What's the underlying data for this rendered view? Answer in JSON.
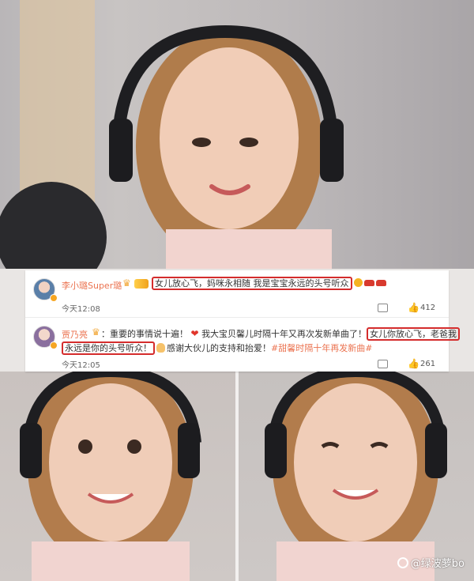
{
  "comments": [
    {
      "username": "李小璐Super璐",
      "text_highlight": "女儿放心飞，妈咪永相随 我是宝宝永远的头号听众",
      "time": "今天12:08",
      "like_count": "412",
      "icons": [
        "crown-icon",
        "vip-badge",
        "emoji-icon",
        "car-icon",
        "comment-icon",
        "like-icon"
      ]
    },
    {
      "username": "贾乃亮",
      "text_before": "：重要的事情说十遍！",
      "text_middle": "我大宝贝馨儿时隔十年又再次发新单曲了！",
      "text_highlight_a": "女儿你放心飞，老爸我",
      "text_highlight_b": "永远是你的头号听众！",
      "text_after": "感谢大伙儿的支持和抬爱！",
      "topic": "#甜馨时隔十年再发新曲#",
      "time": "今天12:05",
      "like_count": "261",
      "icons": [
        "crown-icon",
        "heart-icon",
        "hand-icon",
        "comment-icon",
        "like-icon"
      ]
    }
  ],
  "watermark": "@绿波萝bo",
  "colors": {
    "username": "#eb7350",
    "highlight_box": "#d42c2c",
    "topic": "#eb7350"
  }
}
